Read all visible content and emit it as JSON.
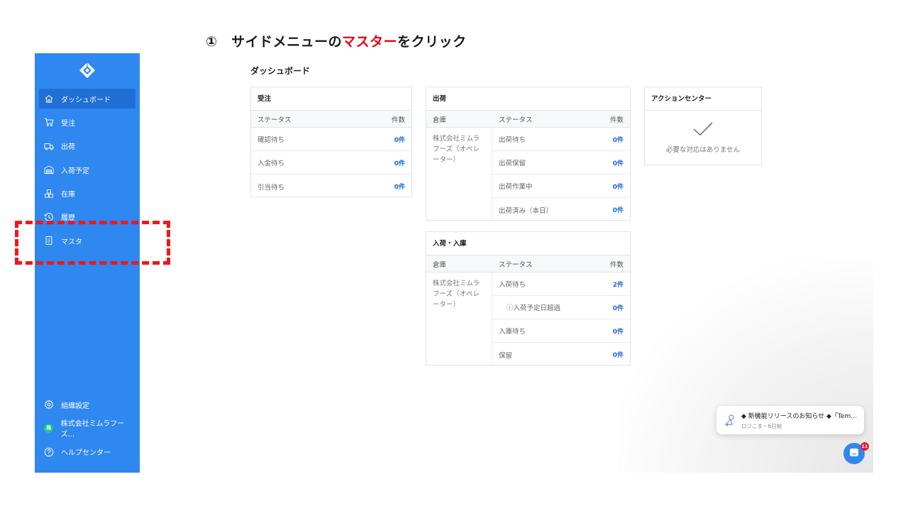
{
  "instruction": {
    "prefix": "①　サイドメニューの",
    "highlight": "マスター",
    "suffix": "をクリック"
  },
  "colors": {
    "sidebar_bg": "#2f87f0",
    "sidebar_active": "#1f6fd6",
    "highlight": "#e60012",
    "count_link": "#1b6bd0"
  },
  "sidebar": {
    "logo_icon": "diamond-logo-icon",
    "items": [
      {
        "label": "ダッシュボード",
        "icon": "home-icon",
        "active": true
      },
      {
        "label": "受注",
        "icon": "cart-icon"
      },
      {
        "label": "出荷",
        "icon": "truck-icon"
      },
      {
        "label": "入荷予定",
        "icon": "warehouse-icon"
      },
      {
        "label": "在庫",
        "icon": "boxes-icon"
      },
      {
        "label": "履歴",
        "icon": "history-icon"
      },
      {
        "label": "マスタ",
        "icon": "document-icon"
      }
    ],
    "bottom": [
      {
        "label": "組織設定",
        "icon": "gear-icon"
      },
      {
        "label": "株式会社ミムラフーズ...",
        "icon": "org-avatar-icon",
        "badge": "株"
      },
      {
        "label": "ヘルプセンター",
        "icon": "help-icon"
      }
    ]
  },
  "main": {
    "title": "ダッシュボード",
    "orders": {
      "title": "受注",
      "headers": {
        "status": "ステータス",
        "count": "件数"
      },
      "rows": [
        {
          "status": "確認待ち",
          "count": "0件"
        },
        {
          "status": "入金待ち",
          "count": "0件"
        },
        {
          "status": "引当待ち",
          "count": "0件"
        }
      ]
    },
    "shipping": {
      "title": "出荷",
      "headers": {
        "warehouse": "倉庫",
        "status": "ステータス",
        "count": "件数"
      },
      "warehouse": "株式会社ミムラフーズ（オペレーター）",
      "rows": [
        {
          "status": "出荷待ち",
          "count": "0件"
        },
        {
          "status": "出荷保留",
          "count": "0件"
        },
        {
          "status": "出荷作業中",
          "count": "0件"
        },
        {
          "status": "出荷済み（本日）",
          "count": "0件"
        }
      ]
    },
    "receiving": {
      "title": "入荷・入庫",
      "headers": {
        "warehouse": "倉庫",
        "status": "ステータス",
        "count": "件数"
      },
      "warehouse": "株式会社ミムラフーズ（オペレーター）",
      "rows": [
        {
          "status": "入荷待ち",
          "count": "2件"
        },
        {
          "status": "ⓘ入荷予定日超過",
          "count": "0件"
        },
        {
          "status": "入庫待ち",
          "count": "0件"
        },
        {
          "status": "保留",
          "count": "0件"
        }
      ]
    },
    "action_center": {
      "title": "アクションセンター",
      "empty_message": "必要な対応はありません",
      "icon": "check-icon"
    }
  },
  "notification": {
    "title": "◆ 新機能リリースのお知らせ ◆「Temu」と...",
    "meta": "ロジこま・6日前",
    "avatar_icon": "robot-avatar-icon"
  },
  "chat": {
    "icon": "chat-icon",
    "badge": "11"
  }
}
